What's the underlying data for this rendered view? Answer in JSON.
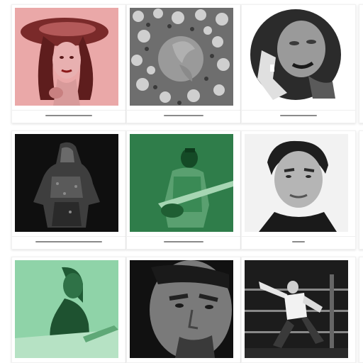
{
  "gallery": {
    "cards": [
      {
        "caption": "........ ........",
        "image": "portrait-woman-hat-icon",
        "tint": "#eaa8a8"
      },
      {
        "caption": "......... ........",
        "image": "floral-pattern-icon",
        "tint": "#8f8f8f"
      },
      {
        "caption": "........ ......",
        "image": "portrait-woman-circle-icon",
        "tint": "#444444"
      },
      {
        "caption": "...... ........ ........",
        "image": "dark-figure-icon",
        "tint": "#1a1a1a"
      },
      {
        "caption": "............",
        "image": "guitarist-icon",
        "tint": "#2f7d4a"
      },
      {
        "caption": ".......",
        "image": "portrait-man-icon",
        "tint": "#e8e8e8"
      },
      {
        "caption": "",
        "image": "woman-profile-icon",
        "tint": "#8fd3a8"
      },
      {
        "caption": "",
        "image": "man-closeup-icon",
        "tint": "#2a2a2a"
      },
      {
        "caption": "",
        "image": "wrestler-icon",
        "tint": "#3a3a3a"
      }
    ]
  }
}
